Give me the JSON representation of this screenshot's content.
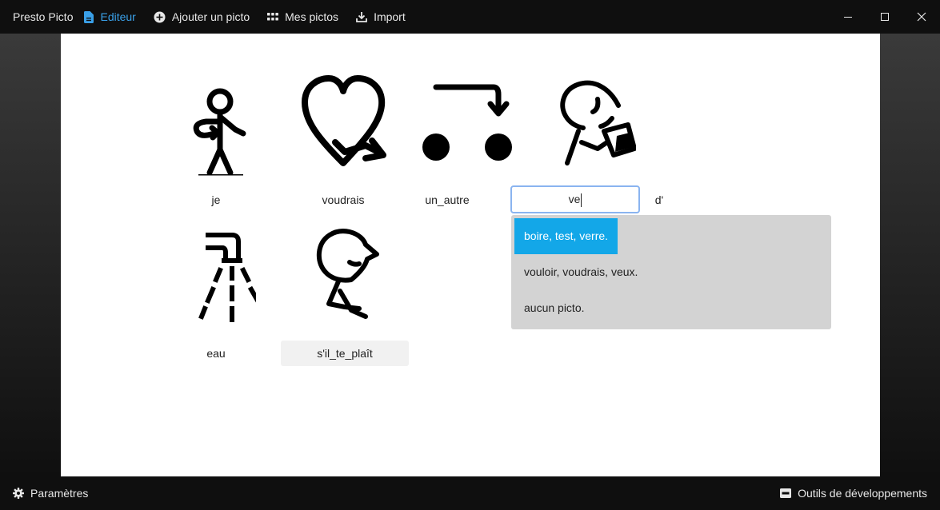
{
  "titlebar": {
    "app_name": "Presto Picto",
    "nav": [
      {
        "label": "Editeur",
        "icon": "document-icon",
        "active": true
      },
      {
        "label": "Ajouter un picto",
        "icon": "add-circle-icon"
      },
      {
        "label": "Mes pictos",
        "icon": "grid-icon"
      },
      {
        "label": "Import",
        "icon": "download-icon"
      }
    ]
  },
  "editor": {
    "words": [
      "je",
      "voudrais",
      "un_autre",
      "d'",
      "eau",
      "s'il_te_plaît"
    ],
    "input_value": "ve",
    "suggestions": [
      "boire,  test,  verre.",
      "vouloir,  voudrais,  veux.",
      "aucun picto."
    ]
  },
  "bottombar": {
    "settings_label": "Paramètres",
    "devtools_label": "Outils de développements"
  },
  "colors": {
    "accent": "#3aa0e8",
    "selected_suggestion": "#13a7e8",
    "suggest_bg": "#d3d3d3"
  }
}
